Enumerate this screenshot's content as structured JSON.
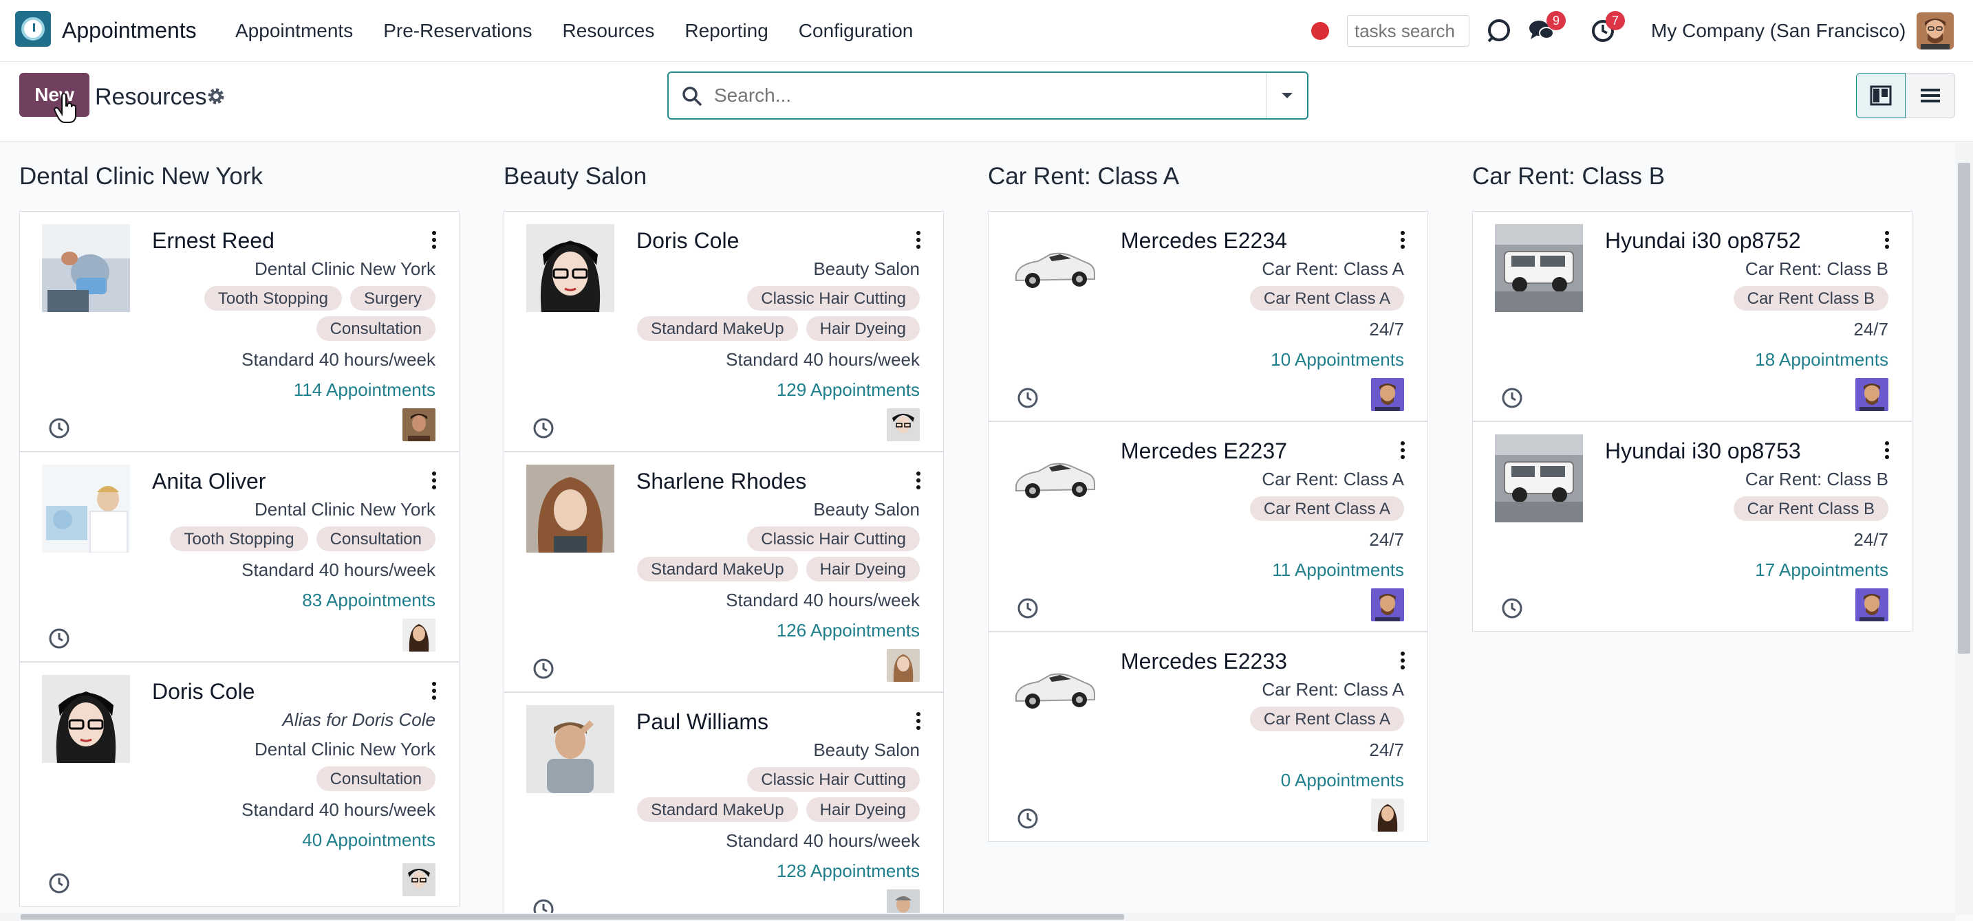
{
  "navbar": {
    "app_name": "Appointments",
    "menu": [
      "Appointments",
      "Pre-Reservations",
      "Resources",
      "Reporting",
      "Configuration"
    ],
    "tasks_search_placeholder": "tasks search",
    "messages_badge": "9",
    "activities_badge": "7",
    "company": "My Company (San Francisco)"
  },
  "control": {
    "new_label": "New",
    "breadcrumb": "Resources",
    "search_placeholder": "Search..."
  },
  "colors": {
    "brand": "#71405e",
    "accent": "#1f7f8c",
    "tag_bg": "#ede2e1",
    "badge": "#dc3545"
  },
  "columns": [
    {
      "title": "Dental Clinic New York",
      "cards": [
        {
          "name": "Ernest Reed",
          "alias": "",
          "location": "Dental Clinic New York",
          "tag_rows": [
            [
              "Tooth Stopping",
              "Surgery"
            ],
            [
              "Consultation"
            ]
          ],
          "schedule": "Standard 40 hours/week",
          "appointments": "114 Appointments"
        },
        {
          "name": "Anita Oliver",
          "alias": "",
          "location": "Dental Clinic New York",
          "tag_rows": [
            [
              "Tooth Stopping",
              "Consultation"
            ]
          ],
          "schedule": "Standard 40 hours/week",
          "appointments": "83 Appointments"
        },
        {
          "name": "Doris Cole",
          "alias": "Alias for Doris Cole",
          "location": "Dental Clinic New York",
          "tag_rows": [
            [
              "Consultation"
            ]
          ],
          "schedule": "Standard 40 hours/week",
          "appointments": "40 Appointments"
        }
      ]
    },
    {
      "title": "Beauty Salon",
      "cards": [
        {
          "name": "Doris Cole",
          "alias": "",
          "location": "Beauty Salon",
          "tag_rows": [
            [
              "Classic Hair Cutting"
            ],
            [
              "Standard MakeUp",
              "Hair Dyeing"
            ]
          ],
          "schedule": "Standard 40 hours/week",
          "appointments": "129 Appointments"
        },
        {
          "name": "Sharlene Rhodes",
          "alias": "",
          "location": "Beauty Salon",
          "tag_rows": [
            [
              "Classic Hair Cutting"
            ],
            [
              "Standard MakeUp",
              "Hair Dyeing"
            ]
          ],
          "schedule": "Standard 40 hours/week",
          "appointments": "126 Appointments"
        },
        {
          "name": "Paul Williams",
          "alias": "",
          "location": "Beauty Salon",
          "tag_rows": [
            [
              "Classic Hair Cutting"
            ],
            [
              "Standard MakeUp",
              "Hair Dyeing"
            ]
          ],
          "schedule": "Standard 40 hours/week",
          "appointments": "128 Appointments"
        }
      ]
    },
    {
      "title": "Car Rent: Class A",
      "cards": [
        {
          "name": "Mercedes E2234",
          "alias": "",
          "location": "Car Rent: Class A",
          "tag_rows": [
            [
              "Car Rent Class A"
            ]
          ],
          "schedule": "24/7",
          "appointments": "10 Appointments"
        },
        {
          "name": "Mercedes E2237",
          "alias": "",
          "location": "Car Rent: Class A",
          "tag_rows": [
            [
              "Car Rent Class A"
            ]
          ],
          "schedule": "24/7",
          "appointments": "11 Appointments"
        },
        {
          "name": "Mercedes E2233",
          "alias": "",
          "location": "Car Rent: Class A",
          "tag_rows": [
            [
              "Car Rent Class A"
            ]
          ],
          "schedule": "24/7",
          "appointments": "0 Appointments"
        }
      ]
    },
    {
      "title": "Car Rent: Class B",
      "cards": [
        {
          "name": "Hyundai i30 op8752",
          "alias": "",
          "location": "Car Rent: Class B",
          "tag_rows": [
            [
              "Car Rent Class B"
            ]
          ],
          "schedule": "24/7",
          "appointments": "18 Appointments"
        },
        {
          "name": "Hyundai i30 op8753",
          "alias": "",
          "location": "Car Rent: Class B",
          "tag_rows": [
            [
              "Car Rent Class B"
            ]
          ],
          "schedule": "24/7",
          "appointments": "17 Appointments"
        }
      ]
    }
  ]
}
